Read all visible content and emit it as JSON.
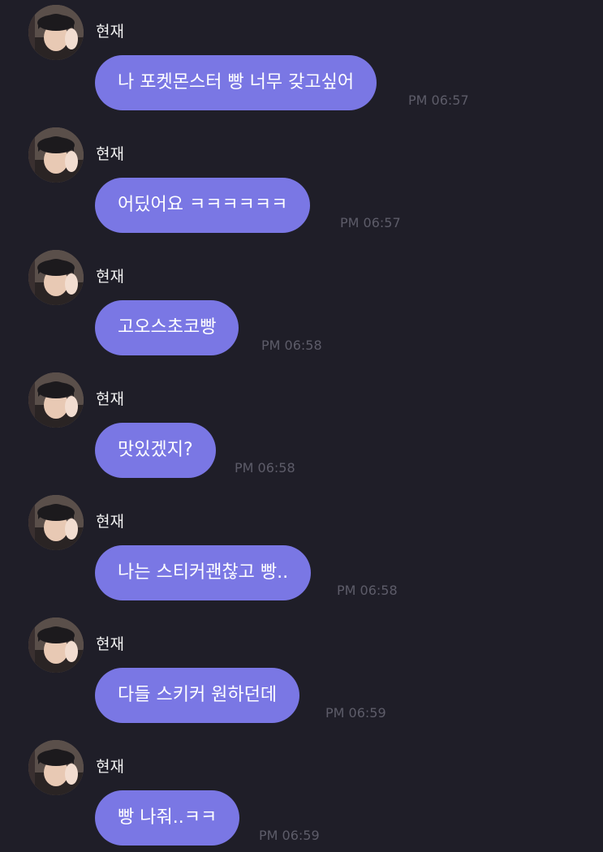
{
  "colors": {
    "background": "#1f1e28",
    "bubble": "#7a77e4",
    "bubble_text": "#ffffff",
    "sender_text": "#f2f2f2",
    "timestamp": "#5d5c69"
  },
  "messages": [
    {
      "sender": "현재",
      "text": "나 포켓몬스터 빵 너무 갖고싶어",
      "time": "PM 06:57",
      "avatar": "profile-photo"
    },
    {
      "sender": "현재",
      "text": "어딨어요 ㅋㅋㅋㅋㅋㅋ",
      "time": "PM 06:57",
      "avatar": "profile-photo"
    },
    {
      "sender": "현재",
      "text": "고오스초코빵",
      "time": "PM 06:58",
      "avatar": "profile-photo"
    },
    {
      "sender": "현재",
      "text": "맛있겠지?",
      "time": "PM 06:58",
      "avatar": "profile-photo"
    },
    {
      "sender": "현재",
      "text": "나는 스티커괜찮고 빵..",
      "time": "PM 06:58",
      "avatar": "profile-photo"
    },
    {
      "sender": "현재",
      "text": "다들 스키커 원하던데",
      "time": "PM 06:59",
      "avatar": "profile-photo"
    },
    {
      "sender": "현재",
      "text": "빵 나줘..ㅋㅋ",
      "time": "PM 06:59",
      "avatar": "profile-photo"
    }
  ]
}
